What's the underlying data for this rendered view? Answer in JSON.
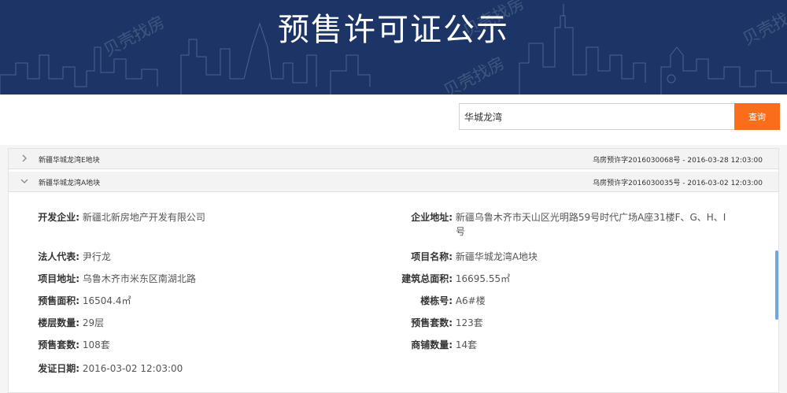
{
  "banner": {
    "title": "预售许可证公示",
    "watermark": "贝壳找房"
  },
  "search": {
    "value": "华城龙湾",
    "button": "查询"
  },
  "list": [
    {
      "name": "新疆华城龙湾E地块",
      "meta": "乌房预许字2016030068号 - 2016-03-28 12:03:00",
      "expanded": false
    },
    {
      "name": "新疆华城龙湾A地块",
      "meta": "乌房预许字2016030035号 - 2016-03-02 12:03:00",
      "expanded": true
    }
  ],
  "detail": {
    "developer": {
      "label": "开发企业:",
      "value": "新疆北新房地产开发有限公司"
    },
    "company_address": {
      "label": "企业地址:",
      "value": "新疆乌鲁木齐市天山区光明路59号时代广场A座31楼F、G、H、I",
      "value2": "号"
    },
    "legal_rep": {
      "label": "法人代表:",
      "value": "尹行龙"
    },
    "project_name": {
      "label": "项目名称:",
      "value": "新疆华城龙湾A地块"
    },
    "project_address": {
      "label": "项目地址:",
      "value": "乌鲁木齐市米东区南湖北路"
    },
    "total_area": {
      "label": "建筑总面积:",
      "value": "16695.55㎡"
    },
    "presale_area": {
      "label": "预售面积:",
      "value": "16504.4㎡"
    },
    "building_no": {
      "label": "楼栋号:",
      "value": "A6#楼"
    },
    "floors": {
      "label": "楼层数量:",
      "value": "29层"
    },
    "presale_units_right": {
      "label": "预售套数:",
      "value": "123套"
    },
    "presale_units_left": {
      "label": "预售套数:",
      "value": "108套"
    },
    "shop_units": {
      "label": "商铺数量:",
      "value": "14套"
    },
    "issue_date": {
      "label": "发证日期:",
      "value": "2016-03-02 12:03:00"
    }
  },
  "colors": {
    "banner": "#1c3566",
    "accent": "#f96d1b",
    "scroll": "#6fa8dc"
  }
}
